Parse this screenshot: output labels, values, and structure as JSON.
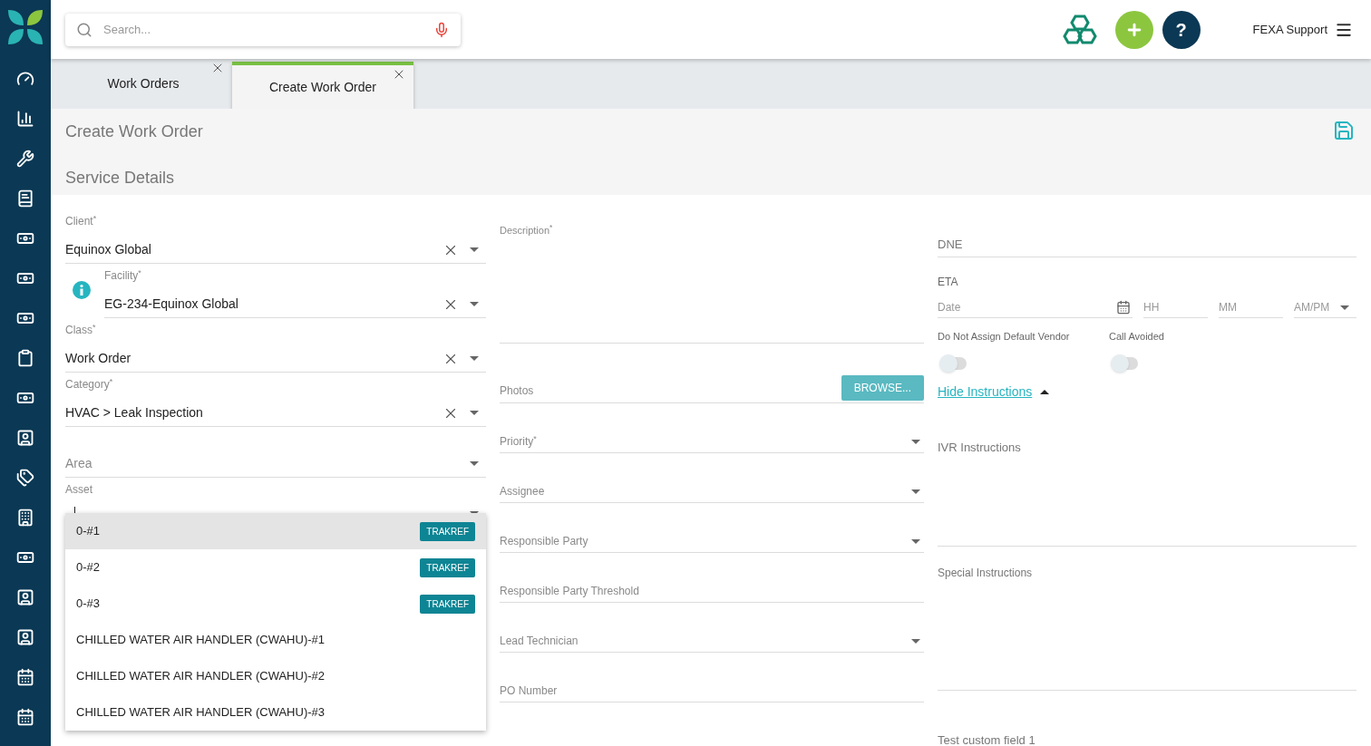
{
  "search": {
    "placeholder": "Search..."
  },
  "header": {
    "help_label": "?",
    "user": "FEXA Support"
  },
  "tabs": [
    {
      "label": "Work Orders",
      "selected": false
    },
    {
      "label": "Create Work Order",
      "selected": true
    }
  ],
  "page_title": "Create Work Order",
  "section_title": "Service Details",
  "left_fields": [
    {
      "kind": "select",
      "label": "Client$^{*}$",
      "value": "Equinox Global",
      "clearable": true,
      "info": false
    },
    {
      "kind": "select",
      "label": "Facility$^{*}$",
      "value": "EG-234-Equinox Global",
      "clearable": true,
      "info": true
    },
    {
      "kind": "select",
      "label": "Class$^{*}$",
      "value": "Work Order",
      "clearable": true,
      "info": false
    },
    {
      "kind": "select",
      "label": "Category$^{*}$",
      "value": "HVAC > Leak Inspection",
      "clearable": true,
      "info": false
    },
    {
      "kind": "empty_select",
      "placeholder": "Area"
    },
    {
      "kind": "combo",
      "label": "Asset",
      "focused": true
    }
  ],
  "asset_options": [
    {
      "label": "0-#1",
      "badge": "TRAKREF",
      "selected": true
    },
    {
      "label": "0-#2",
      "badge": "TRAKREF",
      "selected": false
    },
    {
      "label": "0-#3",
      "badge": "TRAKREF",
      "selected": false
    },
    {
      "label": "CHILLED WATER AIR HANDLER (CWAHU)-#1",
      "selected": false
    },
    {
      "label": "CHILLED WATER AIR HANDLER (CWAHU)-#2",
      "selected": false
    },
    {
      "label": "CHILLED WATER AIR HANDLER (CWAHU)-#3",
      "selected": false
    }
  ],
  "middle_fields": [
    {
      "kind": "textarea",
      "label": "Description$^{*}$"
    },
    {
      "kind": "file",
      "label": "Photos",
      "button": "BROWSE..."
    },
    {
      "kind": "select",
      "placeholder": "Priority$^{*}$"
    },
    {
      "kind": "select",
      "placeholder": "Assignee"
    },
    {
      "kind": "select",
      "placeholder": "Responsible Party"
    },
    {
      "kind": "text",
      "placeholder": "Responsible Party Threshold"
    },
    {
      "kind": "select",
      "placeholder": "Lead Technician"
    },
    {
      "kind": "text",
      "placeholder": "PO Number"
    }
  ],
  "dne": {
    "placeholder": "DNE"
  },
  "eta": {
    "label": "ETA",
    "date": "Date",
    "hour": "HH",
    "minute": "MM",
    "period": "AM/PM"
  },
  "toggles": [
    {
      "label": "Do Not Assign Default Vendor",
      "on": false
    },
    {
      "label": "Call Avoided",
      "on": false
    }
  ],
  "instructions_toggle": {
    "label": "Hide Instructions",
    "expanded": true
  },
  "ivr_instructions": {
    "label": "IVR Instructions"
  },
  "special_instructions": {
    "label": "Special Instructions"
  },
  "custom_field": {
    "placeholder": "Test custom field 1"
  }
}
